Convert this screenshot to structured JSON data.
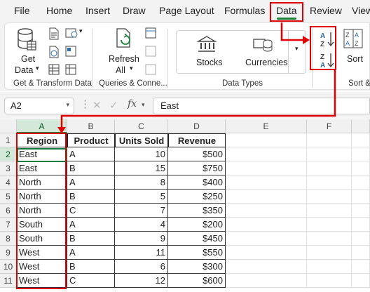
{
  "menu": {
    "tabs": [
      "File",
      "Home",
      "Insert",
      "Draw",
      "Page Layout",
      "Formulas",
      "Data",
      "Review",
      "View"
    ],
    "active_tab": "Data"
  },
  "ribbon": {
    "get_data_label": "Get",
    "get_data_label2": "Data",
    "refresh_label": "Refresh",
    "refresh_label2": "All",
    "stocks_label": "Stocks",
    "currencies_label": "Currencies",
    "sort_label": "Sort",
    "group_get_transform": "Get & Transform Data",
    "group_queries": "Queries & Conne...",
    "group_data_types": "Data Types",
    "group_sort": "Sort &"
  },
  "formula_bar": {
    "name_box": "A2",
    "formula_value": "East",
    "fx_label": "fx"
  },
  "sheet": {
    "columns": [
      "A",
      "B",
      "C",
      "D",
      "E",
      "F"
    ],
    "rows": [
      "1",
      "2",
      "3",
      "4",
      "5",
      "6",
      "7",
      "8",
      "9",
      "10",
      "11"
    ],
    "headers": [
      "Region",
      "Product",
      "Units Sold",
      "Revenue"
    ],
    "data": [
      [
        "East",
        "A",
        "10",
        "$500"
      ],
      [
        "East",
        "B",
        "15",
        "$750"
      ],
      [
        "North",
        "A",
        "8",
        "$400"
      ],
      [
        "North",
        "B",
        "5",
        "$250"
      ],
      [
        "North",
        "C",
        "7",
        "$350"
      ],
      [
        "South",
        "A",
        "4",
        "$200"
      ],
      [
        "South",
        "B",
        "9",
        "$450"
      ],
      [
        "West",
        "A",
        "11",
        "$550"
      ],
      [
        "West",
        "B",
        "6",
        "$300"
      ],
      [
        "West",
        "C",
        "12",
        "$600"
      ]
    ]
  },
  "colors": {
    "accent_green": "#107c41",
    "annotation_red": "#e00000"
  }
}
